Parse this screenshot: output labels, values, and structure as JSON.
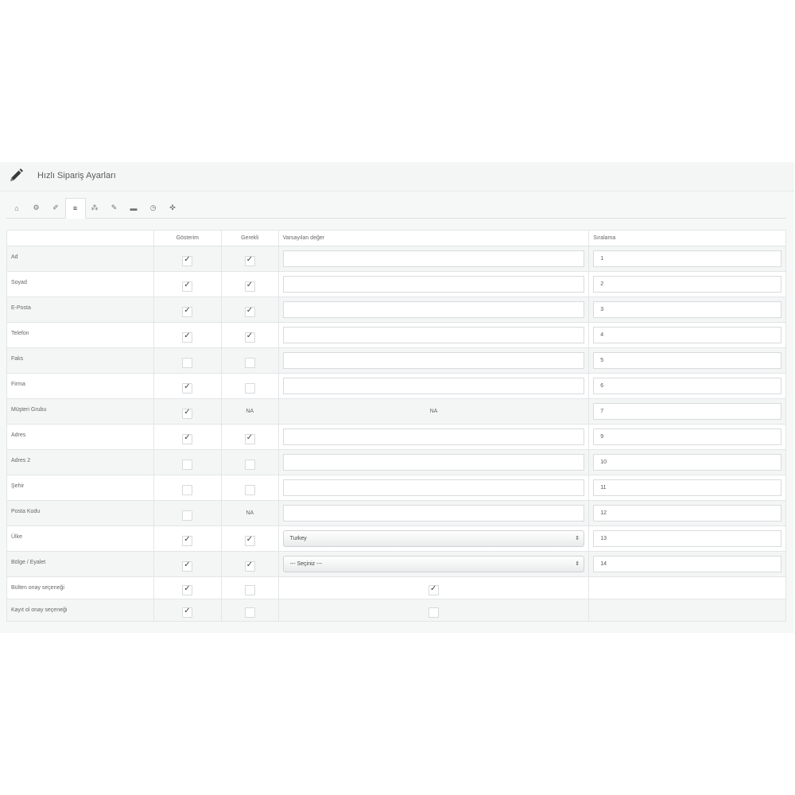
{
  "panel": {
    "title": "Hızlı Sipariş Ayarları",
    "title_icon": "pencil-icon"
  },
  "tabs": [
    {
      "icon": "home-icon",
      "glyph": "⌂"
    },
    {
      "icon": "gear-icon",
      "glyph": "⚙"
    },
    {
      "icon": "wrench-icon",
      "glyph": "✐"
    },
    {
      "icon": "list-icon",
      "glyph": "≡",
      "active": true
    },
    {
      "icon": "sitemap-icon",
      "glyph": "⁂"
    },
    {
      "icon": "edit-icon",
      "glyph": "✎"
    },
    {
      "icon": "truck-icon",
      "glyph": "▬"
    },
    {
      "icon": "clock-icon",
      "glyph": "◷"
    },
    {
      "icon": "puzzle-icon",
      "glyph": "✜"
    }
  ],
  "table": {
    "headers": {
      "show": "Gösterim",
      "required": "Gerekli",
      "default": "Varsayılan değer",
      "order": "Sıralama"
    },
    "rows": [
      {
        "label": "Ad",
        "show": true,
        "required": true,
        "default_type": "input",
        "default_value": "",
        "order": "1"
      },
      {
        "label": "Soyad",
        "show": true,
        "required": true,
        "default_type": "input",
        "default_value": "",
        "order": "2"
      },
      {
        "label": "E-Posta",
        "show": true,
        "required": true,
        "default_type": "input",
        "default_value": "",
        "order": "3"
      },
      {
        "label": "Telefon",
        "show": true,
        "required": true,
        "default_type": "input",
        "default_value": "",
        "order": "4"
      },
      {
        "label": "Faks",
        "show": false,
        "required": false,
        "default_type": "input",
        "default_value": "",
        "order": "5"
      },
      {
        "label": "Firma",
        "show": true,
        "required": false,
        "default_type": "input",
        "default_value": "",
        "order": "6"
      },
      {
        "label": "Müşteri Grubu",
        "show": true,
        "required": "NA",
        "default_type": "na",
        "default_value": "NA",
        "order": "7"
      },
      {
        "label": "Adres",
        "show": true,
        "required": true,
        "default_type": "input",
        "default_value": "",
        "order": "9"
      },
      {
        "label": "Adres 2",
        "show": false,
        "required": false,
        "default_type": "input",
        "default_value": "",
        "order": "10"
      },
      {
        "label": "Şehir",
        "show": false,
        "required": false,
        "default_type": "input",
        "default_value": "",
        "order": "11"
      },
      {
        "label": "Posta Kodu",
        "show": false,
        "required": "NA",
        "default_type": "input",
        "default_value": "",
        "order": "12"
      },
      {
        "label": "Ülke",
        "show": true,
        "required": true,
        "default_type": "select",
        "default_value": "Turkey",
        "order": "13"
      },
      {
        "label": "Bölge / Eyalet",
        "show": true,
        "required": true,
        "default_type": "select",
        "default_value": "--- Seçiniz ---",
        "order": "14"
      },
      {
        "label": "Bülten onay seçeneği",
        "show": true,
        "required": false,
        "default_type": "checkbox",
        "default_value": true,
        "order": null
      },
      {
        "label": "Kayıt ol onay seçeneği",
        "show": true,
        "required": false,
        "default_type": "checkbox",
        "default_value": false,
        "order": null
      }
    ]
  }
}
